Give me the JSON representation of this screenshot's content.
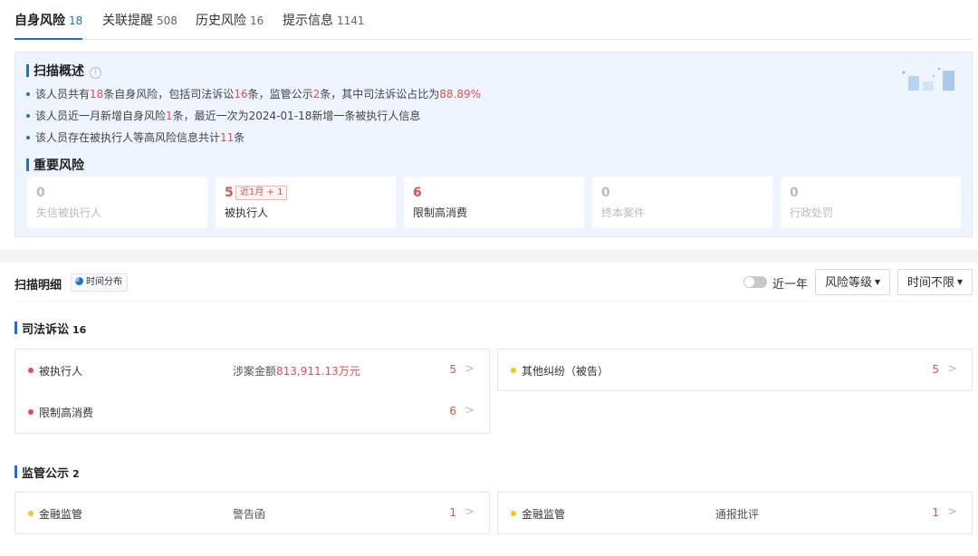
{
  "tabs": [
    {
      "label": "自身风险",
      "count": "18"
    },
    {
      "label": "关联提醒",
      "count": "508"
    },
    {
      "label": "历史风险",
      "count": "16"
    },
    {
      "label": "提示信息",
      "count": "1141"
    }
  ],
  "overview": {
    "title": "扫描概述",
    "info_icon": "i",
    "line1": {
      "p1": "该人员共有",
      "v1": "18",
      "p2": "条自身风险，包括司法诉讼",
      "v2": "16",
      "p3": "条，监管公示",
      "v3": "2",
      "p4": "条，其中司法诉讼占比为",
      "v4": "88.89%"
    },
    "line2": {
      "p1": "该人员近一月新增自身风险",
      "v1": "1",
      "p2": "条，最近一次为2024-01-18新增一条被执行人信息"
    },
    "line3": {
      "p1": "该人员存在被执行人等高风险信息共计",
      "v1": "11",
      "p2": "条"
    }
  },
  "important_risk": {
    "title": "重要风险",
    "cards": [
      {
        "value": "0",
        "label": "失信被执行人"
      },
      {
        "value": "5",
        "label": "被执行人",
        "recent_tag": "近1月 + 1"
      },
      {
        "value": "6",
        "label": "限制高消费"
      },
      {
        "value": "0",
        "label": "终本案件"
      },
      {
        "value": "0",
        "label": "行政处罚"
      }
    ]
  },
  "detail": {
    "title": "扫描明细",
    "time_dist_label": "时间分布",
    "toggle_label": "近一年",
    "toggle_on": false,
    "risk_level_dropdown": "风险等级",
    "time_dropdown": "时间不限"
  },
  "groups": [
    {
      "title": "司法诉讼",
      "count": "16",
      "items": [
        {
          "name": "被执行人",
          "mid": "涉案金额",
          "mid_value": "813,911.13万元",
          "count": "5",
          "dot_color": "#e34d4d"
        },
        {
          "name": "其他纠纷（被告）",
          "mid": "",
          "mid_value": "",
          "count": "5",
          "dot_color": "#f5c518"
        },
        {
          "name": "限制高消费",
          "mid": "",
          "mid_value": "",
          "count": "6",
          "dot_color": "#e34d4d"
        }
      ]
    },
    {
      "title": "监管公示",
      "count": "2",
      "items": [
        {
          "name": "金融监管",
          "mid": "警告函",
          "mid_value": "",
          "count": "1",
          "dot_color": "#f5c518"
        },
        {
          "name": "金融监管",
          "mid": "通报批评",
          "mid_value": "",
          "count": "1",
          "dot_color": "#f5c518"
        }
      ]
    }
  ],
  "colors": {
    "accent": "#1e6fdb",
    "danger": "#e34d4d",
    "warning": "#f5c518"
  }
}
